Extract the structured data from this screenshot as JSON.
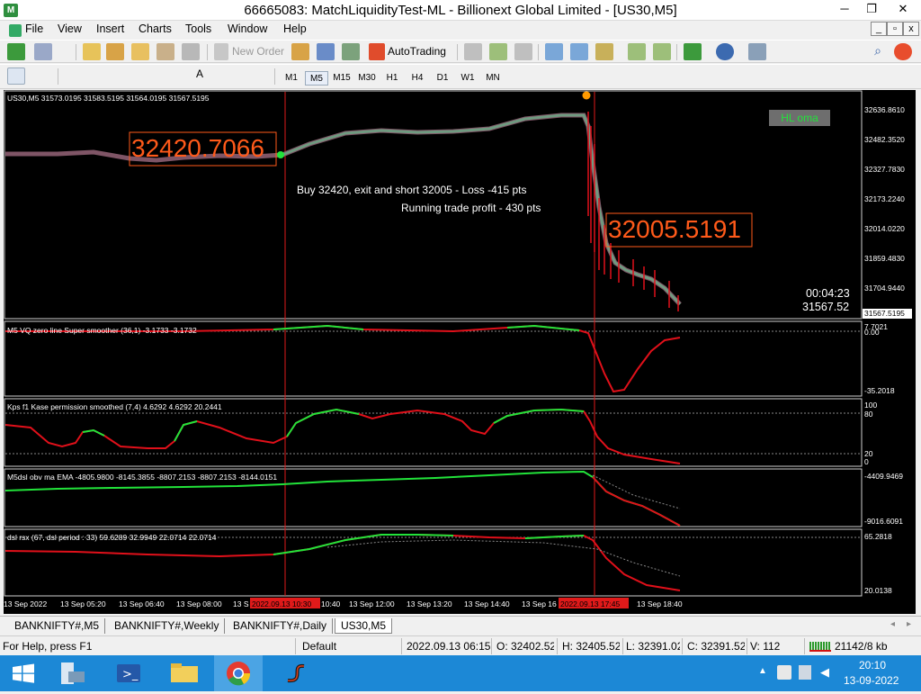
{
  "window": {
    "title": "66665083: MatchLiquidityTest-ML - Billionext Global Limited - [US30,M5]",
    "minimize": "─",
    "restore": "❐",
    "close": "✕"
  },
  "menu": [
    "File",
    "View",
    "Insert",
    "Charts",
    "Tools",
    "Window",
    "Help"
  ],
  "toolbar": {
    "new_order": "New Order",
    "autotrading": "AutoTrading"
  },
  "timeframes": [
    "M1",
    "M5",
    "M15",
    "M30",
    "H1",
    "H4",
    "D1",
    "W1",
    "MN"
  ],
  "active_timeframe": "M5",
  "chart": {
    "symbol_line": "US30,M5  31573.0195 31583.5195 31564.0195 31567.5195",
    "legend_btn": "HL oma",
    "entry_label": "32420.7066",
    "exit_label": "32005.5191",
    "note1": "Buy 32420, exit and short 32005 - Loss -415 pts",
    "note2": "Running trade profit - 430 pts",
    "timer": "00:04:23",
    "last_price": "31567.52",
    "price_tag": "31567.5195",
    "price_axis": [
      "32636.8610",
      "32482.3520",
      "32327.7830",
      "32173.2240",
      "32014.0220",
      "31859.4830",
      "31704.9440"
    ],
    "time_axis": [
      "13 Sep 2022",
      "13 Sep 05:20",
      "13 Sep 06:40",
      "13 Sep 08:00",
      "13 S",
      "10:40",
      "13 Sep 12:00",
      "13 Sep 13:20",
      "13 Sep 14:40",
      "13 Sep 16",
      "13 Sep 18:40"
    ],
    "time_markers": [
      "2022.09.13 10:30",
      "2022.09.13 17:45"
    ],
    "ind1": {
      "label": "M5 VQ zero line Super smoother (36,1) -3.1733 -3.1732",
      "levels": [
        "7.7021",
        "0.00",
        "-35.2018"
      ]
    },
    "ind2": {
      "label": "Kps f1 Kase permission smoothed (7,4) 4.6292 4.6292 20.2441",
      "levels": [
        "100",
        "80",
        "20",
        "0"
      ]
    },
    "ind3": {
      "label": "M5dsl  obv ma  EMA  -4805.9800 -8145.3855 -8807.2153 -8807.2153 -8144.0151",
      "levels": [
        "-4409.9469",
        "-9016.6091"
      ]
    },
    "ind4": {
      "label": "dsl rsx (67, dsl period : 33) 59.6289 32.9949 22.0714 22.0714",
      "levels": [
        "65.2818",
        "20.0138"
      ]
    }
  },
  "tabs": [
    "BANKNIFTY#,M5",
    "BANKNIFTY#,Weekly",
    "BANKNIFTY#,Daily",
    "US30,M5"
  ],
  "status": {
    "help": "For Help, press F1",
    "profile": "Default",
    "datetime": "2022.09.13 06:15",
    "open": "O: 32402.520",
    "high": "H: 32405.520",
    "low": "L: 32391.020",
    "close": "C: 32391.520",
    "volume": "V: 112",
    "traffic": "21142/8 kb"
  },
  "tray": {
    "time": "20:10",
    "date": "13-09-2022"
  },
  "colors": {
    "bull": "#22e33a",
    "bear": "#e0101a",
    "oma": "#6f9a80",
    "label": "#ff5a1a"
  }
}
